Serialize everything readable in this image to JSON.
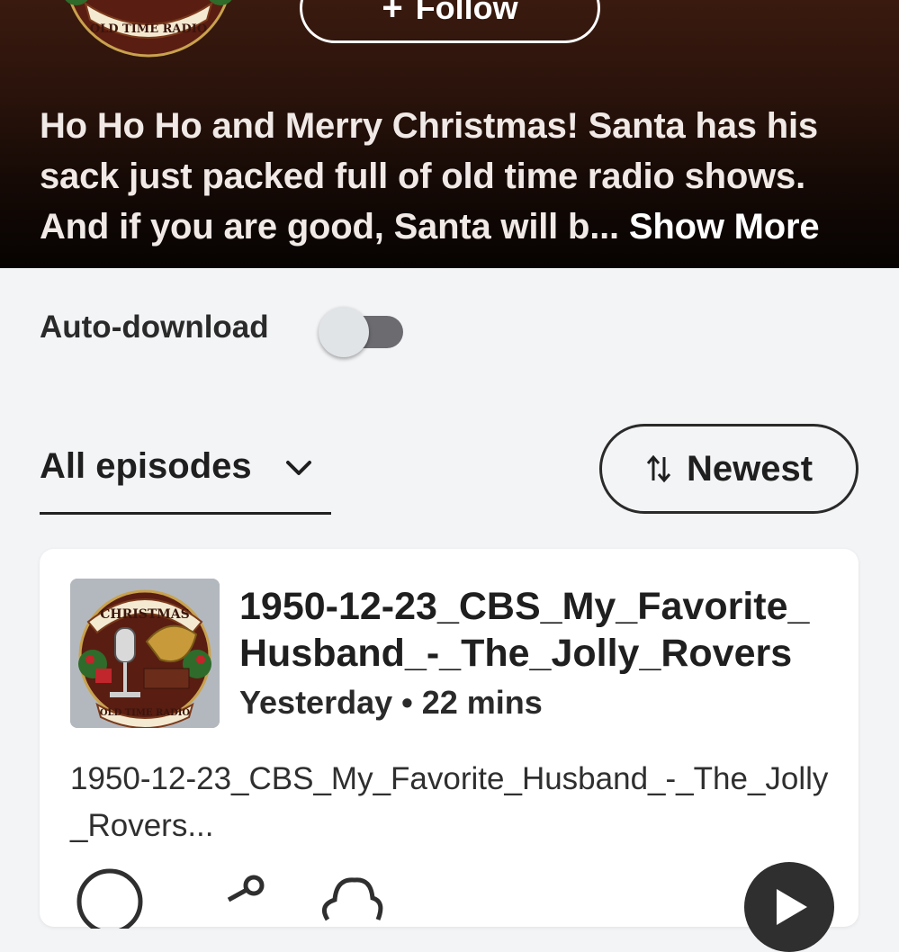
{
  "hero": {
    "logo_text": "OLD TIME RADIO",
    "follow_label": "Follow",
    "follow_icon": "plus-icon",
    "description": "Ho Ho Ho and Merry Christmas! Santa has his sack just packed full of old time radio shows. And if you are good, Santa will b...",
    "show_more_label": "Show More"
  },
  "settings": {
    "auto_download_label": "Auto-download",
    "auto_download_on": false
  },
  "episodes": {
    "filter_label": "All episodes",
    "filter_icon": "chevron-down-icon",
    "sort_label": "Newest",
    "sort_icon": "sort-arrows-icon",
    "items": [
      {
        "art_top_text": "CHRISTMAS",
        "art_bottom_text": "OLD TIME RADIO",
        "title": "1950-12-23_CBS_My_Favorite_ Husband_-_The_Jolly_Rovers",
        "meta": "Yesterday • 22 mins",
        "description": "1950-12-23_CBS_My_Favorite_Husband_-_The_Jolly_Rovers...",
        "actions": [
          "check-circle-icon",
          "share-icon",
          "download-cloud-icon"
        ],
        "play_icon": "play-icon"
      }
    ]
  },
  "colors": {
    "hero_bg_top": "#3a1a0f",
    "hero_bg_bottom": "#070302",
    "page_bg": "#f3f4f6",
    "card_bg": "#ffffff",
    "text_dark": "#1f1f1f"
  }
}
